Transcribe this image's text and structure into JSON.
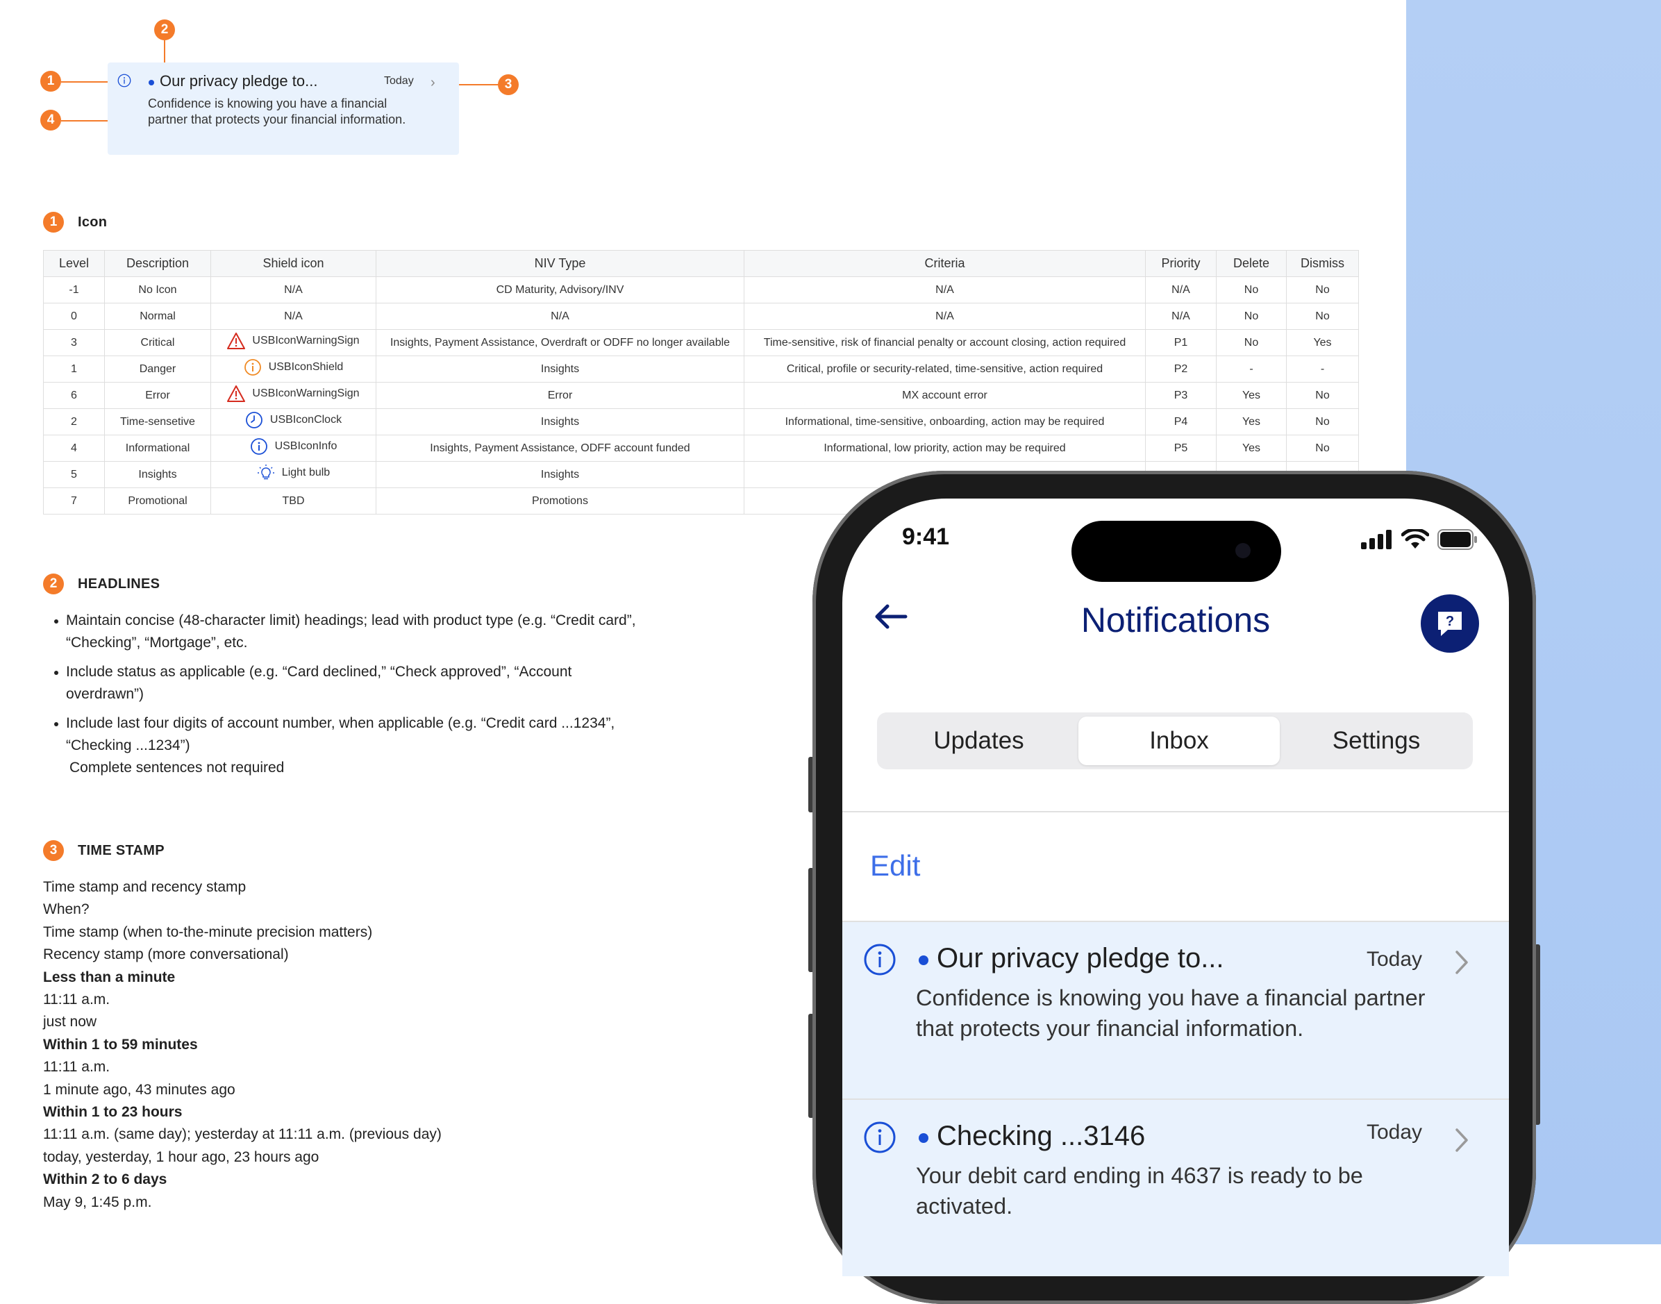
{
  "callout": {
    "badges": [
      "1",
      "2",
      "3",
      "4"
    ],
    "card": {
      "title": "Our privacy pledge to...",
      "time": "Today",
      "body": "Confidence is knowing you have a financial partner that protects your financial information."
    }
  },
  "section_icon": {
    "number": "1",
    "heading": "Icon"
  },
  "table": {
    "headers": [
      "Level",
      "Description",
      "Shield icon",
      "NIV Type",
      "Criteria",
      "Priority",
      "Delete",
      "Dismiss"
    ],
    "rows": [
      {
        "level": "-1",
        "description": "No Icon",
        "icon": "",
        "shield": "N/A",
        "niv": "CD Maturity, Advisory/INV",
        "criteria": "N/A",
        "priority": "N/A",
        "delete": "No",
        "dismiss": "No"
      },
      {
        "level": "0",
        "description": "Normal",
        "icon": "",
        "shield": "N/A",
        "niv": "N/A",
        "criteria": "N/A",
        "priority": "N/A",
        "delete": "No",
        "dismiss": "No"
      },
      {
        "level": "3",
        "description": "Critical",
        "icon": "warning-icon",
        "shield": "USBIconWarningSign",
        "niv": "Insights, Payment Assistance, Overdraft or ODFF no longer available",
        "criteria": "Time-sensitive, risk of financial penalty or account closing, action required",
        "priority": "P1",
        "delete": "No",
        "dismiss": "Yes"
      },
      {
        "level": "1",
        "description": "Danger",
        "icon": "shield-info-icon",
        "shield": "USBIconShield",
        "niv": "Insights",
        "criteria": "Critical, profile or security-related, time-sensitive, action required",
        "priority": "P2",
        "delete": "-",
        "dismiss": "-"
      },
      {
        "level": "6",
        "description": "Error",
        "icon": "warning-icon",
        "shield": "USBIconWarningSign",
        "niv": "Error",
        "criteria": "MX account error",
        "priority": "P3",
        "delete": "Yes",
        "dismiss": "No"
      },
      {
        "level": "2",
        "description": "Time-sensetive",
        "icon": "clock-icon",
        "shield": "USBIconClock",
        "niv": "Insights",
        "criteria": "Informational, time-sensitive, onboarding, action may be required",
        "priority": "P4",
        "delete": "Yes",
        "dismiss": "No"
      },
      {
        "level": "4",
        "description": "Informational",
        "icon": "info-icon",
        "shield": "USBIconInfo",
        "niv": "Insights, Payment Assistance, ODFF account funded",
        "criteria": "Informational, low priority, action may be required",
        "priority": "P5",
        "delete": "Yes",
        "dismiss": "No"
      },
      {
        "level": "5",
        "description": "Insights",
        "icon": "lightbulb-icon",
        "shield": "Light bulb",
        "niv": "Insights",
        "criteria": "",
        "priority": "",
        "delete": "",
        "dismiss": ""
      },
      {
        "level": "7",
        "description": "Promotional",
        "icon": "",
        "shield": "TBD",
        "niv": "Promotions",
        "criteria": "",
        "priority": "",
        "delete": "",
        "dismiss": ""
      }
    ]
  },
  "section_headlines": {
    "number": "2",
    "heading": "HEADLINES",
    "items": [
      "Maintain concise (48-character limit) headings; lead with product type (e.g. “Credit card”, “Checking”, “Mortgage”, etc.",
      "Include status as applicable (e.g. “Card declined,” “Check approved”, “Account overdrawn”)",
      "Include last four digits of account number, when applicable (e.g. “Credit card ...1234”, “Checking ...1234”)"
    ],
    "note": "Complete sentences not required"
  },
  "section_timestamp": {
    "number": "3",
    "heading": "TIME STAMP",
    "lines": [
      {
        "text": "Time stamp and recency stamp",
        "bold": false
      },
      {
        "text": "When?",
        "bold": false
      },
      {
        "text": "Time stamp (when to-the-minute precision matters)",
        "bold": false
      },
      {
        "text": "Recency stamp (more conversational)",
        "bold": false
      },
      {
        "text": "Less than a minute",
        "bold": true
      },
      {
        "text": "11:11 a.m.",
        "bold": false
      },
      {
        "text": "just now",
        "bold": false
      },
      {
        "text": "Within 1 to 59 minutes",
        "bold": true
      },
      {
        "text": "11:11 a.m.",
        "bold": false
      },
      {
        "text": "1 minute ago, 43 minutes ago",
        "bold": false
      },
      {
        "text": "Within 1 to 23 hours",
        "bold": true
      },
      {
        "text": "11:11 a.m. (same day); yesterday at 11:11 a.m. (previous day)",
        "bold": false
      },
      {
        "text": "today, yesterday, 1 hour ago, 23 hours ago",
        "bold": false
      },
      {
        "text": "Within 2 to 6 days",
        "bold": true
      },
      {
        "text": "May 9, 1:45 p.m.",
        "bold": false
      }
    ]
  },
  "phone": {
    "status_time": "9:41",
    "nav_title": "Notifications",
    "tabs": [
      "Updates",
      "Inbox",
      "Settings"
    ],
    "active_tab": "Inbox",
    "edit_label": "Edit",
    "notifications": [
      {
        "title": "Our privacy pledge to...",
        "time": "Today",
        "body": "Confidence is knowing you have a financial partner that protects your financial information."
      },
      {
        "title": "Checking ...3146",
        "time": "Today",
        "body": "Your debit card ending in 4637 is ready to be activated."
      }
    ]
  },
  "colors": {
    "accent_orange": "#f47b2a",
    "brand_navy": "#0c2074",
    "link_blue": "#3d6ee8",
    "card_bg": "#e9f2fd",
    "side_bg": "#b4cff5"
  }
}
